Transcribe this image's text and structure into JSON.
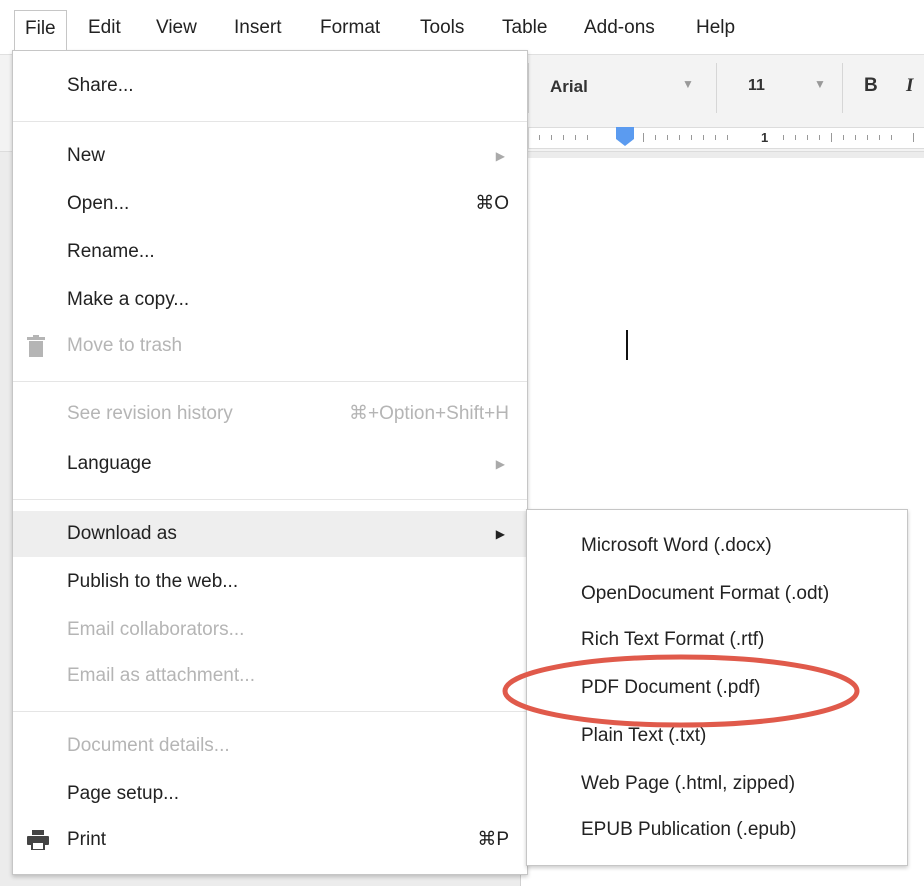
{
  "menubar": {
    "items": [
      {
        "label": "File"
      },
      {
        "label": "Edit"
      },
      {
        "label": "View"
      },
      {
        "label": "Insert"
      },
      {
        "label": "Format"
      },
      {
        "label": "Tools"
      },
      {
        "label": "Table"
      },
      {
        "label": "Add-ons"
      },
      {
        "label": "Help"
      }
    ]
  },
  "toolbar": {
    "font": "Arial",
    "font_size": "11",
    "bold": "B",
    "italic": "I"
  },
  "ruler": {
    "label_1": "1"
  },
  "file_menu": {
    "share": "Share...",
    "new": "New",
    "open": "Open...",
    "open_shortcut": "⌘O",
    "rename": "Rename...",
    "make_copy": "Make a copy...",
    "move_to_trash": "Move to trash",
    "see_revision_history": "See revision history",
    "see_revision_shortcut": "⌘+Option+Shift+H",
    "language": "Language",
    "download_as": "Download as",
    "publish": "Publish to the web...",
    "email_collaborators": "Email collaborators...",
    "email_attachment": "Email as attachment...",
    "document_details": "Document details...",
    "page_setup": "Page setup...",
    "print": "Print",
    "print_shortcut": "⌘P"
  },
  "download_submenu": {
    "items": [
      {
        "label": "Microsoft Word (.docx)"
      },
      {
        "label": "OpenDocument Format (.odt)"
      },
      {
        "label": "Rich Text Format (.rtf)"
      },
      {
        "label": "PDF Document (.pdf)"
      },
      {
        "label": "Plain Text (.txt)"
      },
      {
        "label": "Web Page (.html, zipped)"
      },
      {
        "label": "EPUB Publication (.epub)"
      }
    ]
  },
  "colors": {
    "highlight_ellipse": "#e05a4b",
    "ruler_marker": "#5b9bf0",
    "hover_bg": "#eeeeee",
    "disabled_text": "#b5b5b5"
  }
}
